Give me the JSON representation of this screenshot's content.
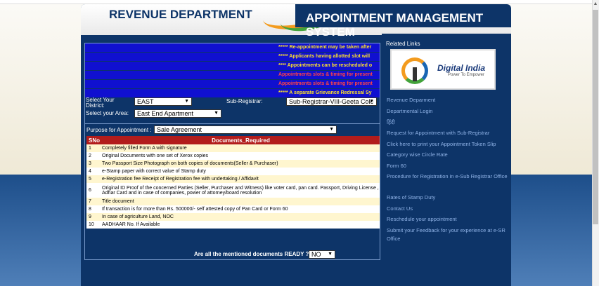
{
  "header": {
    "title_left": "REVENUE DEPARTMENT",
    "title_right": "APPOINTMENT MANAGEMENT SYSTEM"
  },
  "tickers": [
    {
      "text": "***** Re-appointment may be taken after",
      "color": "#ffe22a"
    },
    {
      "text": "***** Applicants having allotted slot will",
      "color": "#ffe22a"
    },
    {
      "text": "**** Appointments can be rescheduled o",
      "color": "#ffe22a"
    },
    {
      "text": "Appointments slots & timing for present",
      "color": "#ff4444"
    },
    {
      "text": "Appointments slots & timing for present",
      "color": "#ff4444"
    },
    {
      "text": "***** A separate Grievance Redressal Sy",
      "color": "#ffe22a"
    }
  ],
  "form": {
    "district_label": "Select Your District:",
    "district_value": "EAST",
    "subregistrar_label": "Sub-Registrar:",
    "subregistrar_value": "Sub-Registrar-VIII-Geeta Colc",
    "area_label": "Select your Area:",
    "area_value": "East End Apartment",
    "purpose_label": "Purpose for Appointment :",
    "purpose_value": "Sale Agreement",
    "ready_label": "Are all the  mentioned documents READY ?",
    "ready_value": "NO"
  },
  "documents": {
    "headers": [
      "SNo",
      "Documents_Required"
    ],
    "rows": [
      {
        "sno": "1",
        "doc": "Completely filled Form A with signature"
      },
      {
        "sno": "2",
        "doc": "Original Documents with one set of Xerox copies"
      },
      {
        "sno": "3",
        "doc": "Two Passport Size Photograph on both copies of documents(Seller & Purchaser)"
      },
      {
        "sno": "4",
        "doc": "e-Stamp paper with correct value of Stamp duty"
      },
      {
        "sno": "5",
        "doc": "e-Registration fee Receipt of Registration fee with undertaking / Affidavit"
      },
      {
        "sno": "6",
        "doc": "Original ID Proof of the concerned Parties (Seller, Purchaser and Witness) like voter card, pan card. Passport, Driving License , Adhar Card and in case of companies, power of attorney/board resolution"
      },
      {
        "sno": "7",
        "doc": "Title document"
      },
      {
        "sno": "8",
        "doc": "If transaction is for more than Rs. 500000/- self attested copy of Pan Card or Form 60"
      },
      {
        "sno": "9",
        "doc": "In case of agriculture Land, NOC"
      },
      {
        "sno": "10",
        "doc": "AADHAAR No. If Available"
      }
    ]
  },
  "sidebar": {
    "related_label": "Related Links",
    "logo_text": "Digital India",
    "logo_tagline": "Power To Empower",
    "links": [
      "Revenue Deparment",
      "Departmental Login",
      "हिंदी",
      "Request for Appointment with Sub-Registrar",
      "Click here to print your Appointment Token Slip",
      "Category wise Circle Rate",
      "Form 60",
      "Procedure for Registration in e-Sub Registrar Office",
      "Rates of Stamp Duty",
      "Contact Us",
      "Reschedule your appointment",
      "Submit your Feedback for your experience at e-SR Office"
    ]
  },
  "icons": {
    "dropdown": "chevron-down-icon",
    "scroll": "scroll-up-arrow-icon"
  }
}
